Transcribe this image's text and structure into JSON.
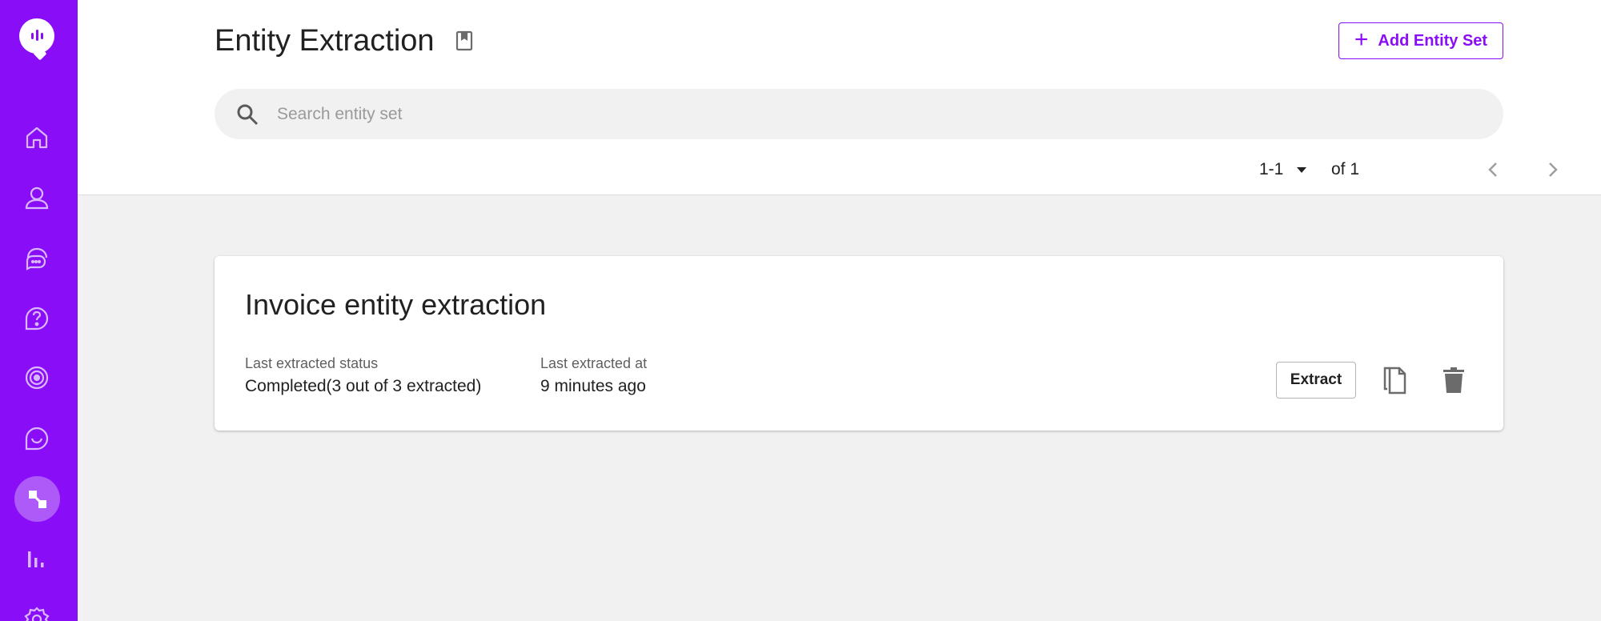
{
  "sidebar": {
    "items": [
      {
        "icon": "home-icon"
      },
      {
        "icon": "user-icon"
      },
      {
        "icon": "chat-bubbles-icon"
      },
      {
        "icon": "help-circle-icon"
      },
      {
        "icon": "target-icon"
      },
      {
        "icon": "chat-smile-icon"
      },
      {
        "icon": "entity-extraction-icon",
        "active": true
      },
      {
        "icon": "bar-chart-icon"
      },
      {
        "icon": "gear-icon"
      }
    ]
  },
  "header": {
    "title": "Entity Extraction",
    "add_button_label": "Add Entity Set",
    "search_placeholder": "Search entity set",
    "search_value": "",
    "pagination": {
      "range": "1-1",
      "total": "of 1"
    }
  },
  "card": {
    "title": "Invoice entity extraction",
    "status_label": "Last extracted status",
    "status_value": "Completed(3 out of 3 extracted)",
    "time_label": "Last extracted at",
    "time_value": "9 minutes ago",
    "extract_label": "Extract"
  },
  "colors": {
    "brand": "#8a0df7",
    "active_item": "#ad5af9",
    "background": "#f1f1f1"
  }
}
